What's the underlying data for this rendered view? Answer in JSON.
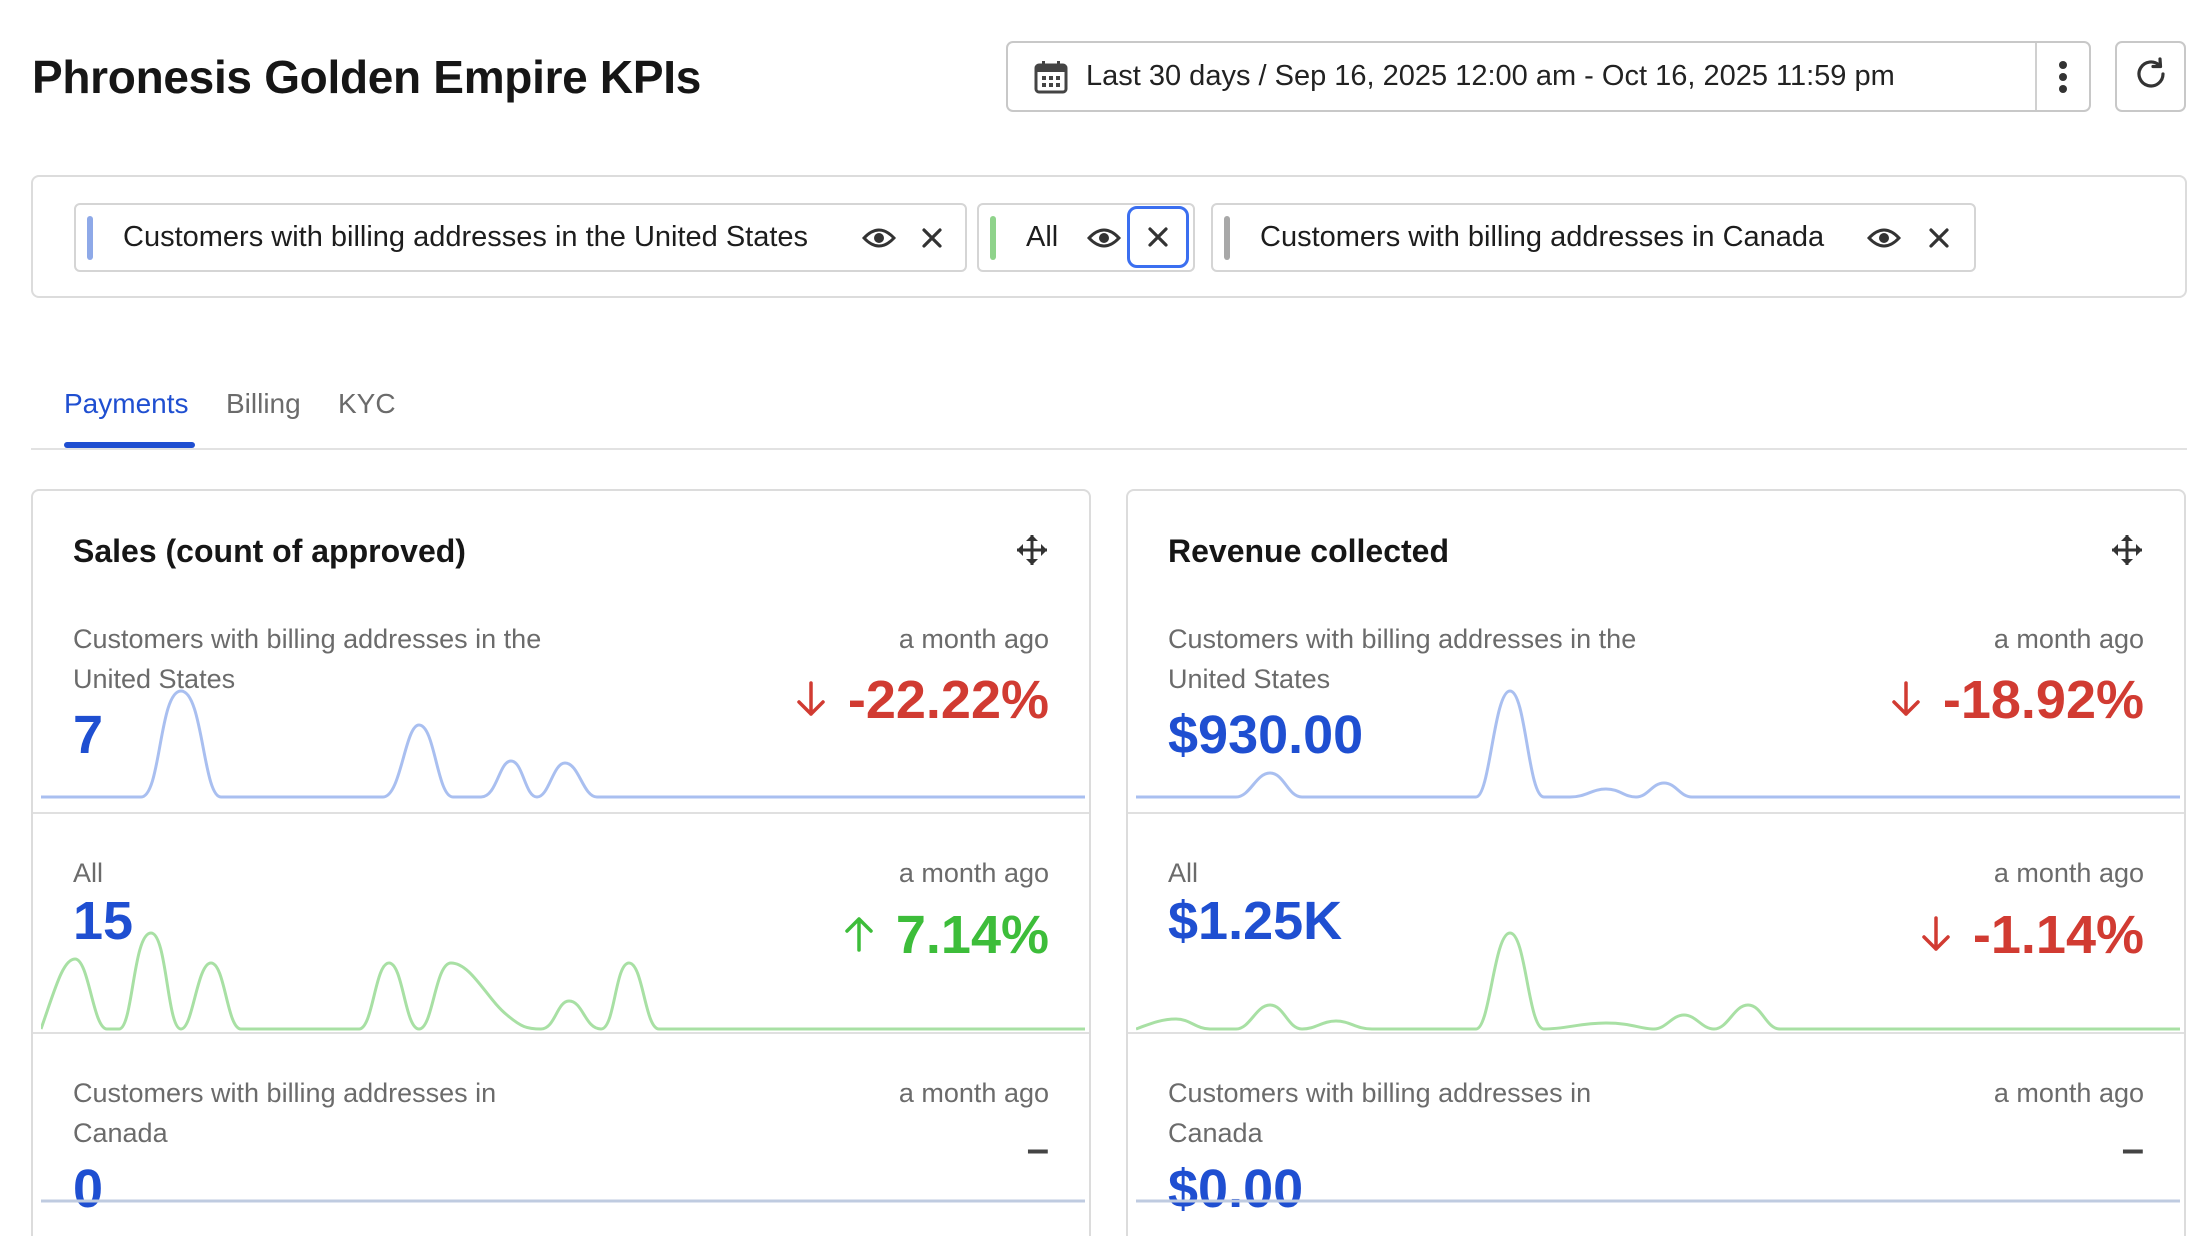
{
  "header": {
    "title": "Phronesis Golden Empire KPIs",
    "date_range": "Last 30 days / Sep 16, 2025 12:00 am - Oct 16, 2025 11:59 pm"
  },
  "filters": [
    {
      "label": "Customers with billing addresses in the United States",
      "color": "#8ea9e8"
    },
    {
      "label": "All",
      "color": "#8fd38b"
    },
    {
      "label": "Customers with billing addresses in Canada",
      "color": "#a8a8a8"
    }
  ],
  "tabs": [
    {
      "label": "Payments",
      "active": true
    },
    {
      "label": "Billing",
      "active": false
    },
    {
      "label": "KYC",
      "active": false
    }
  ],
  "cards": [
    {
      "title": "Sales (count of approved)",
      "rows": [
        {
          "segment": "Customers with billing addresses in the United States",
          "ago": "a month ago",
          "value": "7",
          "delta": "-22.22%",
          "direction": "down"
        },
        {
          "segment": "All",
          "ago": "a month ago",
          "value": "15",
          "delta": "7.14%",
          "direction": "up"
        },
        {
          "segment": "Customers with billing addresses in Canada",
          "ago": "a month ago",
          "value": "0",
          "delta": "–",
          "direction": "flat"
        }
      ]
    },
    {
      "title": "Revenue collected",
      "rows": [
        {
          "segment": "Customers with billing addresses in the United States",
          "ago": "a month ago",
          "value": "$930.00",
          "delta": "-18.92%",
          "direction": "down"
        },
        {
          "segment": "All",
          "ago": "a month ago",
          "value": "$1.25K",
          "delta": "-1.14%",
          "direction": "down"
        },
        {
          "segment": "Customers with billing addresses in Canada",
          "ago": "a month ago",
          "value": "$0.00",
          "delta": "–",
          "direction": "flat"
        }
      ]
    }
  ],
  "icons": {
    "calendar": "calendar-icon",
    "kebab": "kebab-menu-icon",
    "refresh": "refresh-icon",
    "eye": "eye-icon",
    "close": "close-icon",
    "move": "move-icon",
    "arrow_down": "arrow-down-icon",
    "arrow_up": "arrow-up-icon"
  },
  "colors": {
    "accent": "#1f4fd1",
    "negative": "#d13b32",
    "positive": "#3dbd3a",
    "series_us": "#a9bff0",
    "series_all": "#a8e0a4",
    "series_ca": "#bfcbe0"
  }
}
